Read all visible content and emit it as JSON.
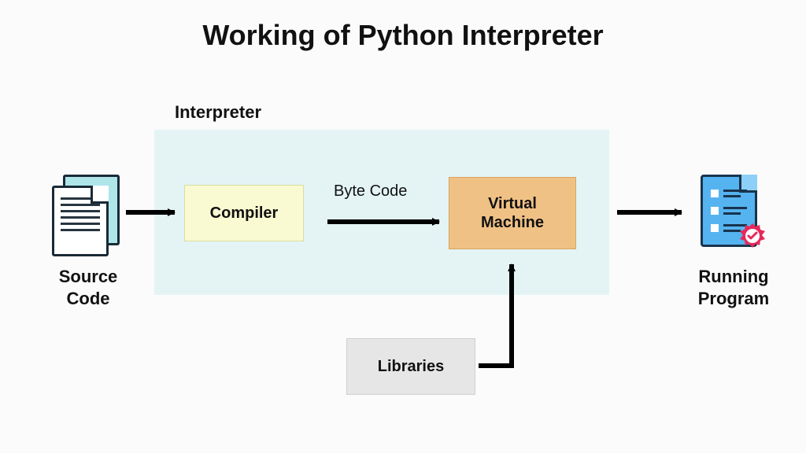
{
  "title": "Working of Python Interpreter",
  "interpreter_label": "Interpreter",
  "compiler_label": "Compiler",
  "byte_code_label": "Byte Code",
  "vm_label": "Virtual\nMachine",
  "libraries_label": "Libraries",
  "source_label": "Source\nCode",
  "running_label": "Running\nProgram",
  "icons": {
    "source": "documents-icon",
    "running": "clipboard-check-icon"
  }
}
